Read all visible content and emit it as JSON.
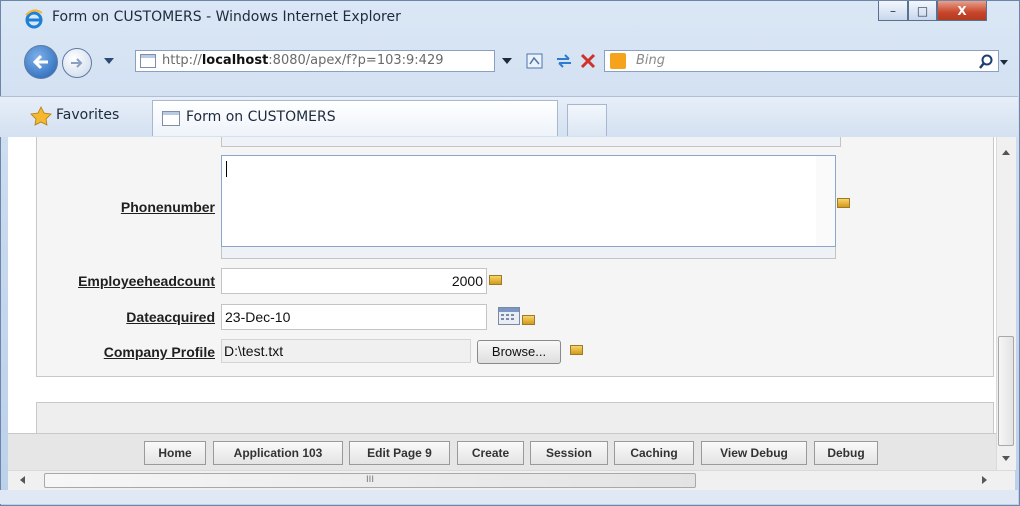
{
  "window": {
    "title": "Form on CUSTOMERS - Windows Internet Explorer",
    "minimize_label": "–",
    "maximize_label": "□",
    "close_label": "X"
  },
  "navigation": {
    "address_prefix": "http://",
    "address_host": "localhost",
    "address_rest": ":8080/apex/f?p=103:9:429",
    "search_placeholder": "Bing"
  },
  "favorites": {
    "favorites_label": "Favorites",
    "tab_title": "Form on CUSTOMERS"
  },
  "form": {
    "phonenumber_label": "Phonenumber",
    "phonenumber_value": "",
    "employeeheadcount_label": "Employeeheadcount",
    "employeeheadcount_value": "2000",
    "dateacquired_label": "Dateacquired",
    "dateacquired_value": "23-Dec-10",
    "company_profile_label": "Company Profile",
    "company_profile_value": "D:\\test.txt",
    "browse_label": "Browse..."
  },
  "developer_toolbar": {
    "buttons": [
      {
        "label": "Home"
      },
      {
        "label": "Application 103"
      },
      {
        "label": "Edit Page 9"
      },
      {
        "label": "Create"
      },
      {
        "label": "Session"
      },
      {
        "label": "Caching"
      },
      {
        "label": "View Debug"
      },
      {
        "label": "Debug"
      }
    ]
  },
  "scrollbar": {
    "grip_label": "III"
  },
  "icons": {
    "browser": "internet-explorer-icon",
    "back": "back-arrow-icon",
    "forward": "forward-arrow-icon",
    "page": "page-icon",
    "compatibility": "compatibility-view-icon",
    "refresh": "refresh-icon",
    "stop": "stop-icon",
    "search_provider": "bing-icon",
    "search": "search-icon",
    "favorites": "star-icon",
    "calendar": "calendar-icon",
    "help": "help-arrow-icon"
  },
  "colors": {
    "window_frame": "#c9daef",
    "close_button": "#c8452b",
    "help_icon": "#f8d46a",
    "favorite_star": "#f5b82e"
  }
}
